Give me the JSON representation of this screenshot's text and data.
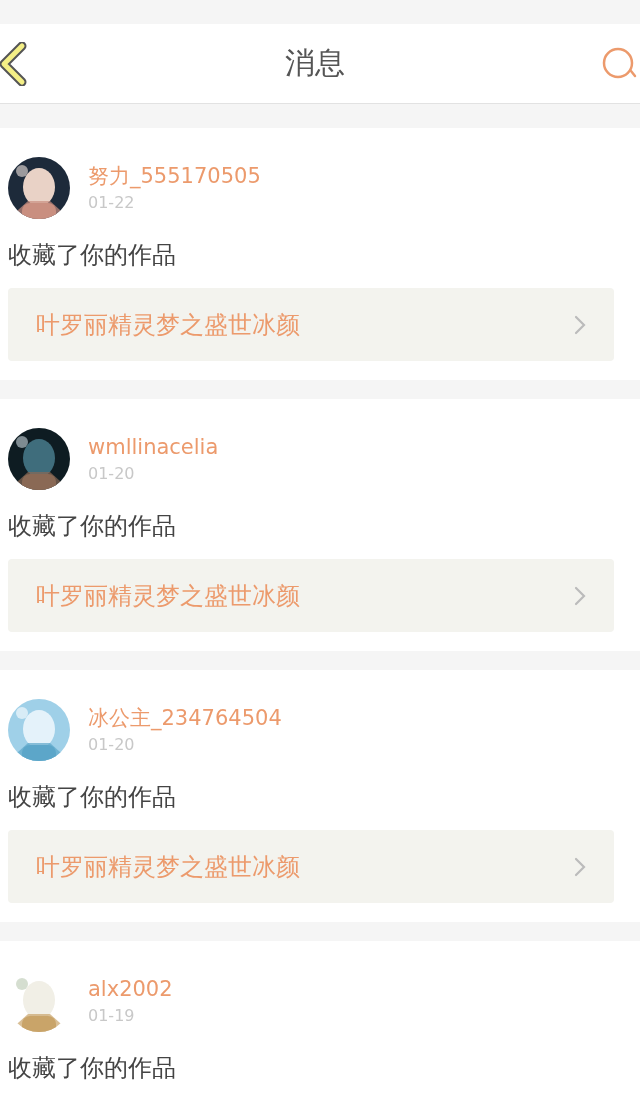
{
  "header": {
    "title": "消息"
  },
  "messages": [
    {
      "user": "努力_555170505",
      "date": "01-22",
      "action": "收藏了你的作品",
      "work": "叶罗丽精灵梦之盛世冰颜"
    },
    {
      "user": "wmllinacelia",
      "date": "01-20",
      "action": "收藏了你的作品",
      "work": "叶罗丽精灵梦之盛世冰颜"
    },
    {
      "user": "冰公主_234764504",
      "date": "01-20",
      "action": "收藏了你的作品",
      "work": "叶罗丽精灵梦之盛世冰颜"
    },
    {
      "user": "alx2002",
      "date": "01-19",
      "action": "收藏了你的作品"
    }
  ]
}
